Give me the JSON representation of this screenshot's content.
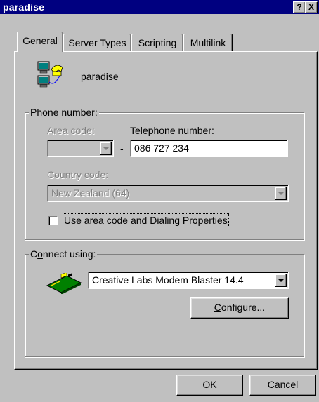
{
  "window": {
    "title": "paradise",
    "help_label": "?",
    "close_label": "X"
  },
  "tabs": [
    {
      "label": "General",
      "active": true
    },
    {
      "label": "Server Types",
      "active": false
    },
    {
      "label": "Scripting",
      "active": false
    },
    {
      "label": "Multilink",
      "active": false
    }
  ],
  "connection": {
    "name": "paradise",
    "icon": "dialup-connection-icon"
  },
  "phone": {
    "group_label": "Phone number:",
    "area_code_label": "Area code:",
    "area_code_value": "",
    "dash": "-",
    "telephone_label_pre": "Tele",
    "telephone_label_accel": "p",
    "telephone_label_post": "hone number:",
    "telephone_value": "086 727 234",
    "country_code_label": "Country code:",
    "country_code_value": "New Zealand (64)",
    "checkbox_accel": "U",
    "checkbox_rest": "se area code and Dialing Properties",
    "checkbox_checked": false
  },
  "connect": {
    "group_label_pre": "C",
    "group_label_accel": "o",
    "group_label_post": "nnect using:",
    "modem_icon": "modem-card-icon",
    "modem_value": "Creative Labs Modem Blaster 14.4",
    "configure_accel": "C",
    "configure_rest": "onfigure..."
  },
  "footer": {
    "ok_label": "OK",
    "cancel_label": "Cancel"
  },
  "colors": {
    "titlebar": "#000080",
    "face": "#c0c0c0"
  }
}
